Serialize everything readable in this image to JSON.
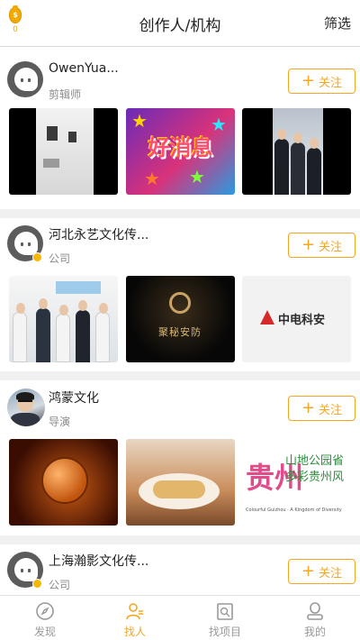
{
  "header": {
    "coin_count": "0",
    "title": "创作人/机构",
    "filter_label": "筛选"
  },
  "follow_label": "关注",
  "cards": [
    {
      "name": "OwenYua...",
      "role": "剪辑师",
      "avatar": "default-avatar",
      "verified": false,
      "thumbs": [
        "gallery-room",
        "good-news-banner",
        "people-on-stage"
      ]
    },
    {
      "name": "河北永艺文化传...",
      "role": "公司",
      "avatar": "default-avatar",
      "verified": true,
      "thumbs": [
        "office-team",
        "gold-logo-dark",
        "red-triangle-logo"
      ],
      "thumb_texts": {
        "logo_dark": "聚秘安防",
        "logo_light": "中电科安"
      }
    },
    {
      "name": "鸿蒙文化",
      "role": "导演",
      "avatar": "user-photo",
      "verified": false,
      "thumbs": [
        "flaming-basketball",
        "food-plate",
        "guizhou-calligraphy"
      ],
      "thumb_texts": {
        "calligraphy_main": "贵州",
        "calligraphy_side": "山地公园省 多彩贵州风",
        "calligraphy_small": "Colourful Guizhou · A Kingdom of Diversity"
      }
    },
    {
      "name": "上海瀚影文化传...",
      "role": "公司",
      "avatar": "default-avatar",
      "verified": true,
      "thumbs": []
    }
  ],
  "tabbar": {
    "items": [
      {
        "label": "发现",
        "icon": "compass-icon",
        "active": false
      },
      {
        "label": "找人",
        "icon": "person-icon",
        "active": true
      },
      {
        "label": "找项目",
        "icon": "search-project-icon",
        "active": false
      },
      {
        "label": "我的",
        "icon": "profile-icon",
        "active": false
      }
    ]
  },
  "colors": {
    "accent": "#f5a623",
    "divider": "#f0f0f0",
    "muted": "#8a8a8a"
  }
}
